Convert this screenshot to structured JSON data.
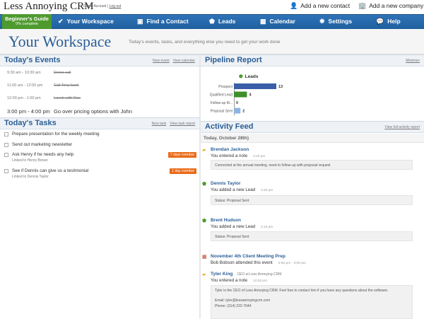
{
  "app": {
    "brand": "Less Annoying CRM",
    "account_prefix": "Guest Account |",
    "logout": "Log out"
  },
  "quick_actions": [
    {
      "icon": "add-user-icon",
      "label": "Add a new contact"
    },
    {
      "icon": "add-company-icon",
      "label": "Add a new company"
    }
  ],
  "guide": {
    "title": "Beginner's Guide",
    "progress": "0% complete",
    "progress_value": 0
  },
  "nav": [
    {
      "label": "Your Workspace",
      "icon": "check-icon"
    },
    {
      "label": "Find a Contact",
      "icon": "contact-card-icon"
    },
    {
      "label": "Leads",
      "icon": "tag-icon"
    },
    {
      "label": "Calendar",
      "icon": "calendar-icon"
    },
    {
      "label": "Settings",
      "icon": "gear-icon"
    },
    {
      "label": "Help",
      "icon": "help-bubble-icon"
    }
  ],
  "header": {
    "title": "Your Workspace",
    "subtitle": "Today's events, tasks, and everything else you need to get your work done"
  },
  "events": {
    "title": "Today's Events",
    "links": [
      "New event",
      "View calendar"
    ],
    "items": [
      {
        "time": "9:30 am - 10:30 am",
        "name": "Demo call",
        "done": true
      },
      {
        "time": "11:00 am - 12:00 pm",
        "name": "Call Tony back",
        "done": true
      },
      {
        "time": "12:00 pm - 1:00 pm",
        "name": "Lunch with Dan",
        "done": true
      },
      {
        "time": "3:00 pm - 4:00 pm",
        "name": "Go over pricing options with John",
        "done": false
      }
    ]
  },
  "tasks": {
    "title": "Today's Tasks",
    "links": [
      "New task",
      "View task report"
    ],
    "items": [
      {
        "label": "Prepare presentation for the weekly meeting",
        "link": "",
        "badge": ""
      },
      {
        "label": "Send out marketing newsletter",
        "link": "",
        "badge": ""
      },
      {
        "label": "Ask Henry if he needs any help",
        "link": "Linked to Henry Brown",
        "badge": "7 days overdue"
      },
      {
        "label": "See if Dennis can give us a testimonial",
        "link": "Linked to Dennis Taylor",
        "badge": "1 day overdue"
      }
    ]
  },
  "pipeline": {
    "title": "Pipeline Report",
    "links": [
      "Minimize"
    ]
  },
  "chart_data": {
    "type": "bar",
    "orientation": "horizontal",
    "title": "Leads",
    "categories": [
      "Prospect",
      "Qualified Lead",
      "Follow-up M...",
      "Proposal Sent"
    ],
    "values": [
      13,
      4,
      0,
      2
    ],
    "colors": [
      "#3b5ea8",
      "#3f8f2a",
      "#888888",
      "#8fb3e0"
    ],
    "xlim": [
      0,
      13
    ]
  },
  "feed": {
    "title": "Activity Feed",
    "links": [
      "View full activity report"
    ],
    "day": "Today, October 28th)",
    "entries": [
      {
        "icon": "note-icon",
        "who": "Brendan Jackson",
        "role": "",
        "action": "You entered a note",
        "time": "2:20 pm",
        "box": [
          "Connected at the annual meeting, need to follow-up with proposal request"
        ]
      },
      {
        "icon": "tag-icon",
        "who": "Dennis Taylor",
        "role": "",
        "action": "You added a new Lead",
        "time": "2:20 pm",
        "box": [
          "Status: Proposal Sent"
        ]
      },
      {
        "icon": "tag-icon",
        "who": "Brent Hudson",
        "role": "",
        "action": "You added a new Lead",
        "time": "2:19 pm",
        "box": [
          "Status: Proposal Sent"
        ]
      },
      {
        "icon": "calendar-icon",
        "who": "November 4th Client Meeting Prep",
        "role": "",
        "action": "Bob Bobson attended this event",
        "time": "2:00 pm - 3:00 pm",
        "box": []
      },
      {
        "icon": "note-icon",
        "who": "Tyler King",
        "role": "CEO at Less Annoying CRM",
        "action": "You entered a note",
        "time": "12:53 pm",
        "box": [
          "Tyler is the CEO of Less Annoying CRM. Feel free to contact him if you have any questions about the software.",
          "",
          "Email: tyler@lessannoyingcrm.com",
          "Phone: (314) 222-7644"
        ]
      }
    ]
  }
}
